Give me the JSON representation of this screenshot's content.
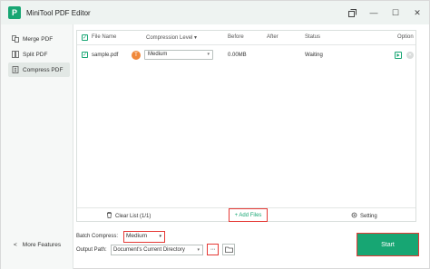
{
  "app": {
    "title": "MiniTool PDF Editor",
    "logo_letter": "P"
  },
  "window_controls": {
    "restore_icon": "restore-icon",
    "minimize": "—",
    "maximize": "☐",
    "close": "✕"
  },
  "sidebar": {
    "items": [
      {
        "label": "Merge PDF",
        "icon": "merge-icon"
      },
      {
        "label": "Split PDF",
        "icon": "split-icon"
      },
      {
        "label": "Compress PDF",
        "icon": "compress-icon",
        "active": true
      }
    ],
    "more_features": "More Features"
  },
  "table": {
    "headers": {
      "file_name": "File Name",
      "compression_level": "Compression Level",
      "before": "Before",
      "after": "After",
      "status": "Status",
      "option": "Option"
    },
    "rows": [
      {
        "file_name": "sample.pdf",
        "avatar": "T",
        "compression_level": "Medium",
        "before": "0.00MB",
        "after": "",
        "status": "Waiting"
      }
    ]
  },
  "footer": {
    "clear_list": "Clear List (1/1)",
    "add_files": "+ Add Files",
    "setting": "Setting"
  },
  "batch": {
    "label": "Batch Compress:",
    "value": "Medium"
  },
  "output": {
    "label": "Output Path:",
    "value": "Document's Current Directory",
    "dots": "···"
  },
  "start_button": "Start",
  "colors": {
    "accent": "#17a673",
    "highlight": "#e53935"
  }
}
